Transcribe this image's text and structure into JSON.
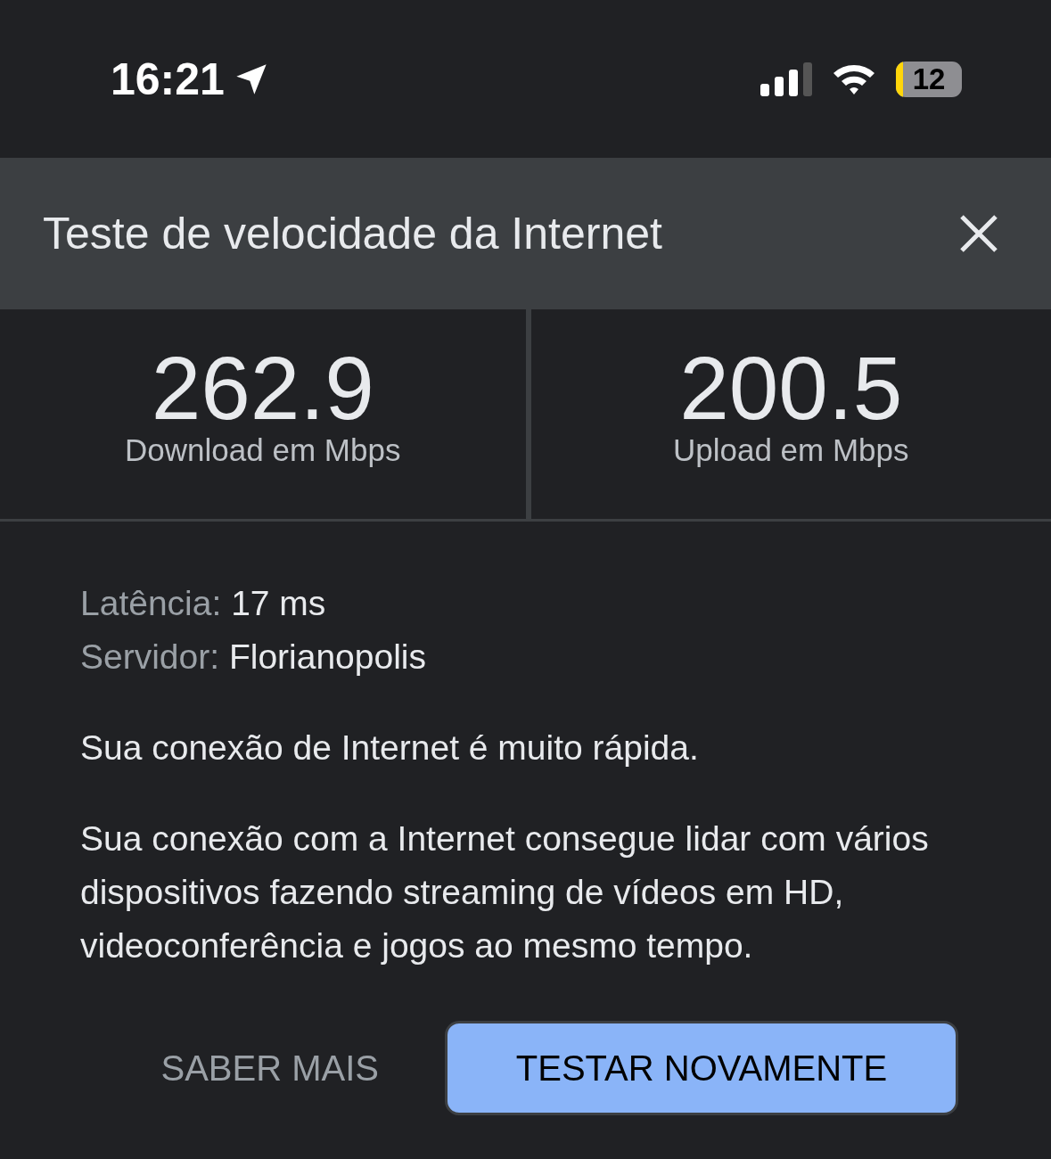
{
  "status_bar": {
    "time": "16:21",
    "battery": "12"
  },
  "dialog": {
    "title": "Teste de velocidade da Internet"
  },
  "metrics": [
    {
      "value": "262.9",
      "label": "Download em Mbps"
    },
    {
      "value": "200.5",
      "label": "Upload em Mbps"
    }
  ],
  "details": [
    {
      "label": "Latência:",
      "value": "17 ms"
    },
    {
      "label": "Servidor:",
      "value": "Florianopolis"
    }
  ],
  "summary": "Sua conexão de Internet é muito rápida.",
  "description": "Sua conexão com a Internet consegue lidar com vários dispositivos fazendo streaming de vídeos em HD, videoconferência e jogos ao mesmo tempo.",
  "buttons": [
    {
      "label": "SABER MAIS",
      "kind": "text"
    },
    {
      "label": "TESTAR NOVAMENTE",
      "kind": "filled"
    }
  ]
}
